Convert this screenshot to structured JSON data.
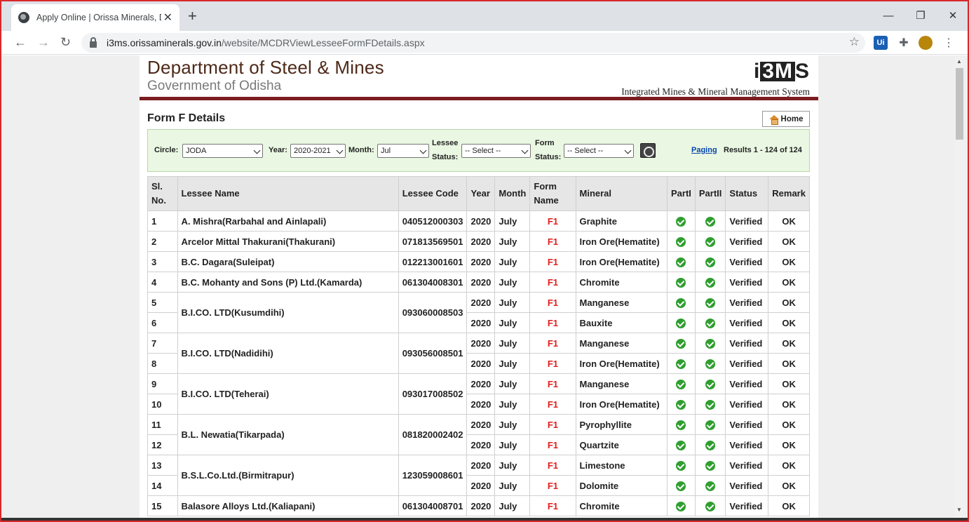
{
  "browser": {
    "tab_title": "Apply Online | Orissa Minerals, D",
    "url_host": "i3ms.orissaminerals.gov.in",
    "url_path": "/website/MCDRViewLesseeFormFDetails.aspx",
    "ext_ui": "Ui"
  },
  "header": {
    "dept": "Department of Steel & Mines",
    "gov": "Government of Odisha",
    "logo_left": "i",
    "logo_mid": "3M",
    "logo_right": "S",
    "tagline": "Integrated Mines & Mineral Management System"
  },
  "form_title": "Form F Details",
  "home_label": "Home",
  "filters": {
    "circle_label": "Circle:",
    "circle_value": "JODA",
    "year_label": "Year:",
    "year_value": "2020-2021",
    "month_label": "Month:",
    "month_value": "Jul",
    "lessee_label_1": "Lessee",
    "lessee_label_2": "Status:",
    "lessee_value": "-- Select --",
    "form_label_1": "Form",
    "form_label_2": "Status:",
    "form_value": "-- Select --",
    "paging": "Paging",
    "results": "Results 1 - 124 of 124"
  },
  "table": {
    "headers": {
      "sl_1": "Sl.",
      "sl_2": "No.",
      "lessee": "Lessee Name",
      "code": "Lessee Code",
      "year": "Year",
      "month": "Month",
      "form_1": "Form",
      "form_2": "Name",
      "mineral": "Mineral",
      "part1": "PartI",
      "part2": "PartII",
      "status": "Status",
      "remark": "Remark"
    },
    "rows": [
      {
        "sl": "1",
        "lessee": "A. Mishra(Rarbahal and Ainlapali)",
        "code": "040512000303",
        "span": 1,
        "year": "2020",
        "month": "July",
        "form": "F1",
        "mineral": "Graphite",
        "status": "Verified",
        "remark": "OK"
      },
      {
        "sl": "2",
        "lessee": "Arcelor Mittal Thakurani(Thakurani)",
        "code": "071813569501",
        "span": 1,
        "year": "2020",
        "month": "July",
        "form": "F1",
        "mineral": "Iron Ore(Hematite)",
        "status": "Verified",
        "remark": "OK"
      },
      {
        "sl": "3",
        "lessee": "B.C. Dagara(Suleipat)",
        "code": "012213001601",
        "span": 1,
        "year": "2020",
        "month": "July",
        "form": "F1",
        "mineral": "Iron Ore(Hematite)",
        "status": "Verified",
        "remark": "OK"
      },
      {
        "sl": "4",
        "lessee": "B.C. Mohanty and Sons (P) Ltd.(Kamarda)",
        "code": "061304008301",
        "span": 1,
        "year": "2020",
        "month": "July",
        "form": "F1",
        "mineral": "Chromite",
        "status": "Verified",
        "remark": "OK"
      },
      {
        "sl": "5",
        "lessee": "B.I.CO. LTD(Kusumdihi)",
        "code": "093060008503",
        "span": 2,
        "year": "2020",
        "month": "July",
        "form": "F1",
        "mineral": "Manganese",
        "status": "Verified",
        "remark": "OK"
      },
      {
        "sl": "6",
        "lessee": "",
        "code": "",
        "span": 0,
        "year": "2020",
        "month": "July",
        "form": "F1",
        "mineral": "Bauxite",
        "status": "Verified",
        "remark": "OK"
      },
      {
        "sl": "7",
        "lessee": "B.I.CO. LTD(Nadidihi)",
        "code": "093056008501",
        "span": 2,
        "year": "2020",
        "month": "July",
        "form": "F1",
        "mineral": "Manganese",
        "status": "Verified",
        "remark": "OK"
      },
      {
        "sl": "8",
        "lessee": "",
        "code": "",
        "span": 0,
        "year": "2020",
        "month": "July",
        "form": "F1",
        "mineral": "Iron Ore(Hematite)",
        "status": "Verified",
        "remark": "OK"
      },
      {
        "sl": "9",
        "lessee": "B.I.CO. LTD(Teherai)",
        "code": "093017008502",
        "span": 2,
        "year": "2020",
        "month": "July",
        "form": "F1",
        "mineral": "Manganese",
        "status": "Verified",
        "remark": "OK"
      },
      {
        "sl": "10",
        "lessee": "",
        "code": "",
        "span": 0,
        "year": "2020",
        "month": "July",
        "form": "F1",
        "mineral": "Iron Ore(Hematite)",
        "status": "Verified",
        "remark": "OK"
      },
      {
        "sl": "11",
        "lessee": "B.L. Newatia(Tikarpada)",
        "code": "081820002402",
        "span": 2,
        "year": "2020",
        "month": "July",
        "form": "F1",
        "mineral": "Pyrophyllite",
        "status": "Verified",
        "remark": "OK"
      },
      {
        "sl": "12",
        "lessee": "",
        "code": "",
        "span": 0,
        "year": "2020",
        "month": "July",
        "form": "F1",
        "mineral": "Quartzite",
        "status": "Verified",
        "remark": "OK"
      },
      {
        "sl": "13",
        "lessee": "B.S.L.Co.Ltd.(Birmitrapur)",
        "code": "123059008601",
        "span": 2,
        "year": "2020",
        "month": "July",
        "form": "F1",
        "mineral": "Limestone",
        "status": "Verified",
        "remark": "OK"
      },
      {
        "sl": "14",
        "lessee": "",
        "code": "",
        "span": 0,
        "year": "2020",
        "month": "July",
        "form": "F1",
        "mineral": "Dolomite",
        "status": "Verified",
        "remark": "OK"
      },
      {
        "sl": "15",
        "lessee": "Balasore Alloys Ltd.(Kaliapani)",
        "code": "061304008701",
        "span": 1,
        "year": "2020",
        "month": "July",
        "form": "F1",
        "mineral": "Chromite",
        "status": "Verified",
        "remark": "OK"
      }
    ]
  }
}
